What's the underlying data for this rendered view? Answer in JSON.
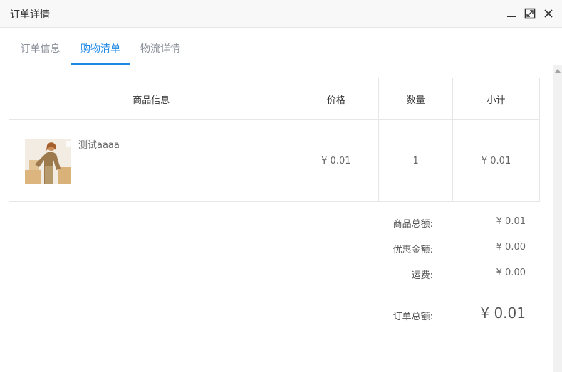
{
  "window": {
    "title": "订单详情"
  },
  "tabs": [
    {
      "label": "订单信息",
      "active": false
    },
    {
      "label": "购物清单",
      "active": true
    },
    {
      "label": "物流详情",
      "active": false
    }
  ],
  "table": {
    "headers": {
      "info": "商品信息",
      "price": "价格",
      "qty": "数量",
      "subtotal": "小计"
    },
    "rows": [
      {
        "name": "测试aaaa",
        "price": "¥ 0.01",
        "qty": "1",
        "subtotal": "¥ 0.01"
      }
    ]
  },
  "summary": {
    "goods_total_label": "商品总额:",
    "goods_total_value": "¥ 0.01",
    "discount_label": "优惠金额:",
    "discount_value": "¥ 0.00",
    "shipping_label": "运费:",
    "shipping_value": "¥ 0.00",
    "order_total_label": "订单总额:",
    "order_total_value": "¥ 0.01"
  },
  "colors": {
    "accent": "#1e88e5",
    "border": "#e6e6e6",
    "titlebar_bg": "#f8f8f8"
  }
}
